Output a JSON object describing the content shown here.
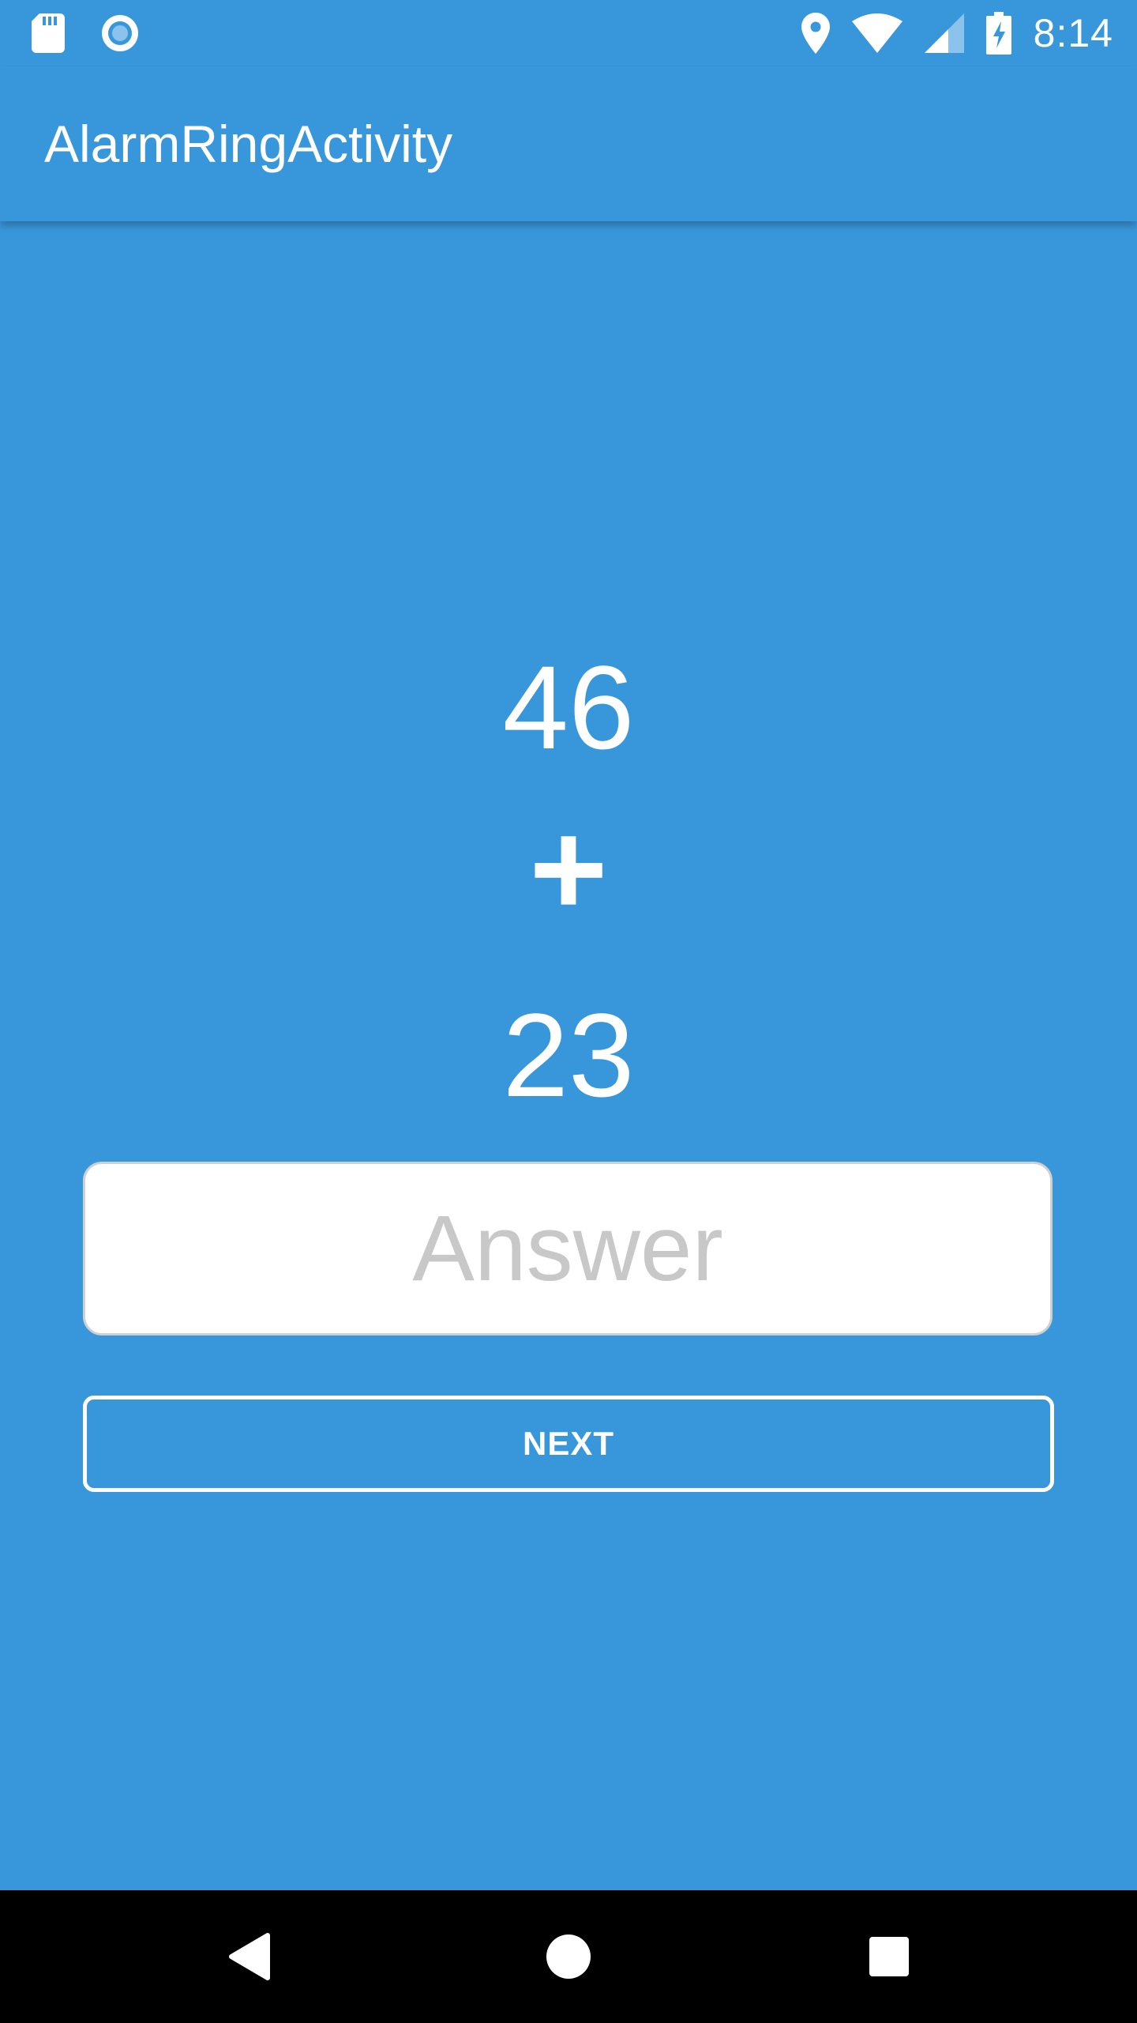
{
  "status_bar": {
    "time": "8:14",
    "left_icons": [
      "sd-card-icon",
      "record-icon"
    ],
    "right_icons": [
      "location-icon",
      "wifi-icon",
      "cell-signal-icon",
      "battery-charging-icon"
    ]
  },
  "app_bar": {
    "title": "AlarmRingActivity"
  },
  "problem": {
    "operand1": "46",
    "operator": "+",
    "operand2": "23"
  },
  "answer": {
    "value": "",
    "placeholder": "Answer"
  },
  "next_button": {
    "label": "NEXT"
  },
  "nav_bar": {
    "icons": [
      "back-icon",
      "home-icon",
      "recents-icon"
    ]
  },
  "colors": {
    "background": "#3897DA",
    "text": "#FFFFFF",
    "input_background": "#FFFFFF",
    "placeholder": "#C8C8C8",
    "nav_bar": "#000000"
  }
}
